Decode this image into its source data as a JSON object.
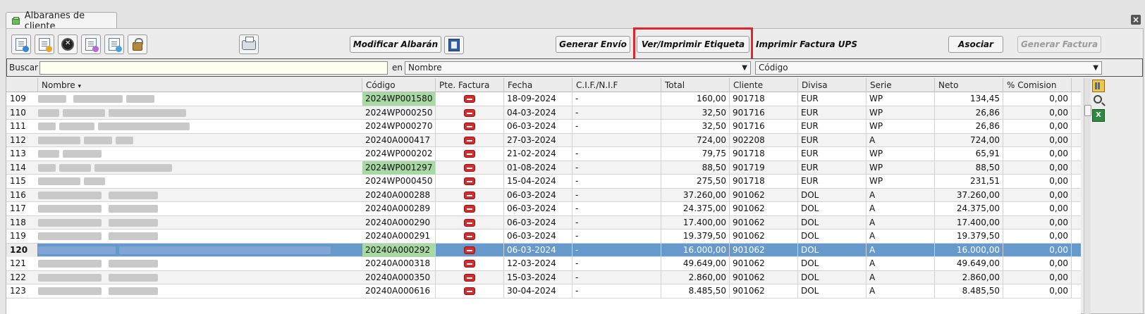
{
  "tab": {
    "title": "Albaranes de cliente"
  },
  "toolbar": {
    "icons": [
      "new-document-icon",
      "edit-document-icon",
      "cancel-circle-icon",
      "copy-document-icon",
      "export-document-icon",
      "lock-icon",
      "printer-icon",
      "book-icon"
    ],
    "modificar_label": "Modificar Albarán",
    "generar_envio_label": "Generar Envío",
    "ver_imprimir_label": "Ver/Imprimir Etiqueta",
    "imprimir_factura_label": "Imprimir Factura UPS",
    "asociar_label": "Asociar",
    "generar_factura_label": "Generar Factura"
  },
  "search": {
    "label": "Buscar",
    "value": "",
    "en_label": "en",
    "field_select": "Nombre",
    "order_select": "Código"
  },
  "table": {
    "columns": [
      "Nombre",
      "Código",
      "Pte. Factura",
      "Fecha",
      "C.I.F./N.I.F",
      "Total",
      "Cliente",
      "Divisa",
      "Serie",
      "Neto",
      "% Comision"
    ],
    "rows": [
      {
        "n": "109",
        "codigo": "2024WP001580",
        "fecha": "18-09-2024",
        "cif": "-",
        "total": "160,00",
        "cliente": "901718",
        "divisa": "EUR",
        "serie": "WP",
        "neto": "134,45",
        "comision": "0,00"
      },
      {
        "n": "110",
        "codigo": "2024WP000250",
        "fecha": "04-03-2024",
        "cif": "-",
        "total": "32,50",
        "cliente": "901716",
        "divisa": "EUR",
        "serie": "WP",
        "neto": "26,86",
        "comision": "0,00"
      },
      {
        "n": "111",
        "codigo": "2024WP000270",
        "fecha": "06-03-2024",
        "cif": "-",
        "total": "32,50",
        "cliente": "901716",
        "divisa": "EUR",
        "serie": "WP",
        "neto": "26,86",
        "comision": "0,00"
      },
      {
        "n": "112",
        "codigo": "20240A000417",
        "fecha": "27-03-2024",
        "cif": "",
        "total": "724,00",
        "cliente": "902208",
        "divisa": "EUR",
        "serie": "A",
        "neto": "724,00",
        "comision": "0,00"
      },
      {
        "n": "113",
        "codigo": "2024WP000202",
        "fecha": "21-02-2024",
        "cif": "-",
        "total": "79,75",
        "cliente": "901718",
        "divisa": "EUR",
        "serie": "WP",
        "neto": "65,91",
        "comision": "0,00"
      },
      {
        "n": "114",
        "codigo": "2024WP001297",
        "fecha": "01-08-2024",
        "cif": "-",
        "total": "88,50",
        "cliente": "901719",
        "divisa": "EUR",
        "serie": "WP",
        "neto": "88,50",
        "comision": "0,00"
      },
      {
        "n": "115",
        "codigo": "2024WP000450",
        "fecha": "15-04-2024",
        "cif": "-",
        "total": "275,50",
        "cliente": "901718",
        "divisa": "EUR",
        "serie": "WP",
        "neto": "231,51",
        "comision": "0,00"
      },
      {
        "n": "116",
        "codigo": "20240A000288",
        "fecha": "06-03-2024",
        "cif": "-",
        "total": "37.260,00",
        "cliente": "901062",
        "divisa": "DOL",
        "serie": "A",
        "neto": "37.260,00",
        "comision": "0,00"
      },
      {
        "n": "117",
        "codigo": "20240A000289",
        "fecha": "06-03-2024",
        "cif": "-",
        "total": "24.375,00",
        "cliente": "901062",
        "divisa": "DOL",
        "serie": "A",
        "neto": "24.375,00",
        "comision": "0,00"
      },
      {
        "n": "118",
        "codigo": "20240A000290",
        "fecha": "06-03-2024",
        "cif": "-",
        "total": "17.400,00",
        "cliente": "901062",
        "divisa": "DOL",
        "serie": "A",
        "neto": "17.400,00",
        "comision": "0,00"
      },
      {
        "n": "119",
        "codigo": "20240A000291",
        "fecha": "06-03-2024",
        "cif": "-",
        "total": "19.379,50",
        "cliente": "901062",
        "divisa": "DOL",
        "serie": "A",
        "neto": "19.379,50",
        "comision": "0,00"
      },
      {
        "n": "120",
        "codigo": "20240A000292",
        "fecha": "06-03-2024",
        "cif": "-",
        "total": "16.000,00",
        "cliente": "901062",
        "divisa": "DOL",
        "serie": "A",
        "neto": "16.000,00",
        "comision": "0,00"
      },
      {
        "n": "121",
        "codigo": "20240A000318",
        "fecha": "12-03-2024",
        "cif": "-",
        "total": "49.649,00",
        "cliente": "901062",
        "divisa": "DOL",
        "serie": "A",
        "neto": "49.649,00",
        "comision": "0,00"
      },
      {
        "n": "122",
        "codigo": "20240A000350",
        "fecha": "15-03-2024",
        "cif": "-",
        "total": "2.860,00",
        "cliente": "901062",
        "divisa": "DOL",
        "serie": "A",
        "neto": "2.860,00",
        "comision": "0,00"
      },
      {
        "n": "123",
        "codigo": "20240A000616",
        "fecha": "30-04-2024",
        "cif": "-",
        "total": "8.485,50",
        "cliente": "901062",
        "divisa": "DOL",
        "serie": "A",
        "neto": "8.485,50",
        "comision": "0,00"
      }
    ],
    "selected_row": "120",
    "green_codes": [
      "2024WP001580",
      "2024WP001297",
      "20240A000292"
    ]
  },
  "colors": {
    "selection": "#6699cc",
    "highlight_border": "#e0262d",
    "green_cell": "#a8d8a3",
    "pending_badge": "#d42c2c"
  },
  "side_icons": [
    "columns-config-icon",
    "search-icon",
    "excel-export-icon"
  ]
}
